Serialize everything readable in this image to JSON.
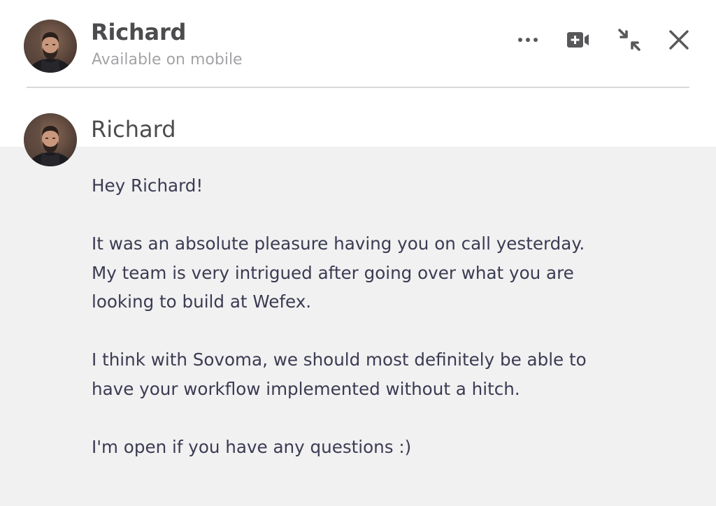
{
  "header": {
    "contact_name": "Richard",
    "status": "Available on mobile",
    "actions": {
      "more_icon": "more-horizontal-icon",
      "video_icon": "video-call-icon",
      "minimize_icon": "minimize-arrows-icon",
      "close_icon": "close-icon"
    }
  },
  "message": {
    "sender": "Richard",
    "paragraphs": [
      "Hey Richard!",
      "It was an absolute pleasure having you on call yesterday.\nMy team is very intrigued after going over what you are\nlooking to build at Wefex.",
      "I think with Sovoma, we should most definitely be able to\nhave your workflow implemented without a hitch.",
      "I'm open if you have any questions :)"
    ]
  },
  "colors": {
    "text_primary": "#4c4c4e",
    "text_secondary": "#a4a4a7",
    "message_text": "#3b3b52",
    "message_background": "#f1f1f2",
    "icon": "#58585b"
  }
}
